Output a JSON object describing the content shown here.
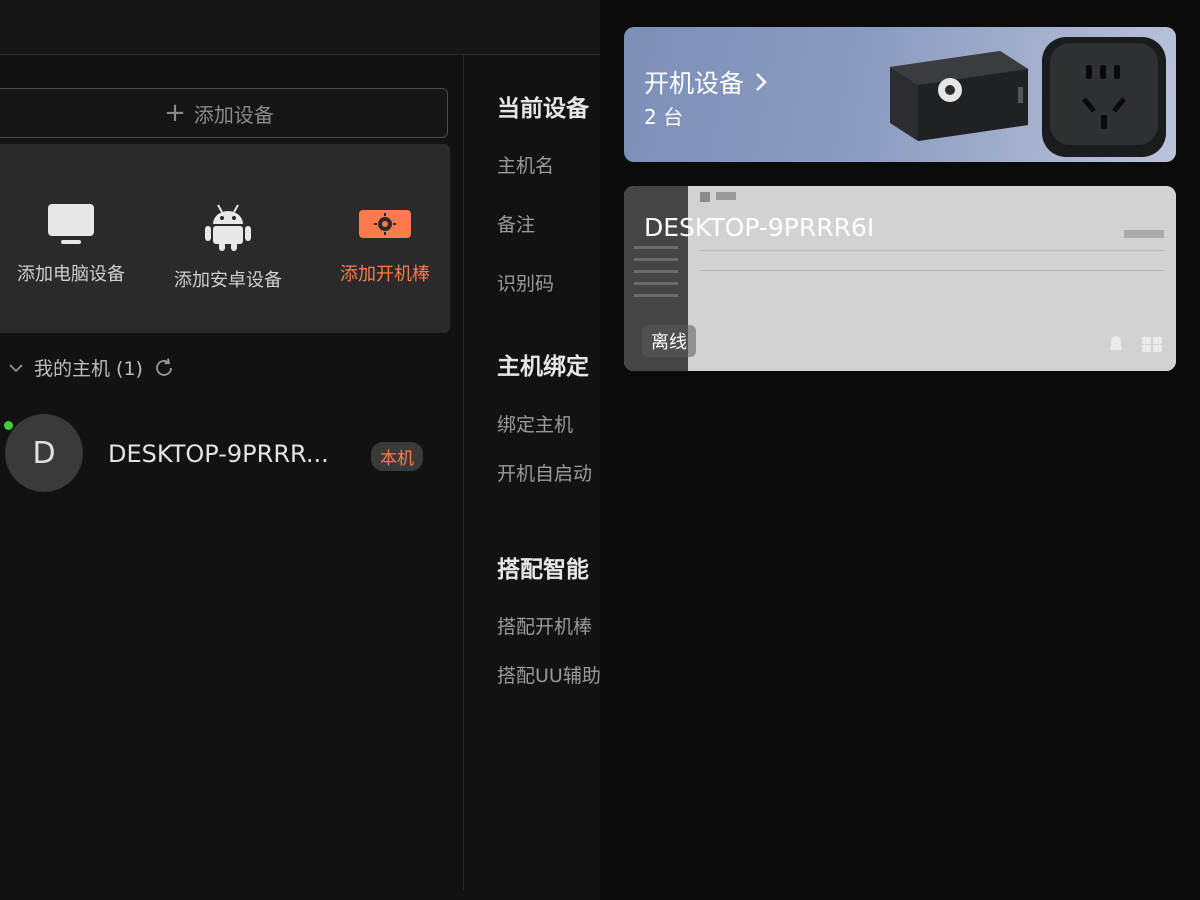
{
  "left_panel": {
    "add_device_button": "添加设备",
    "add_options": [
      {
        "label": "添加电脑设备",
        "icon": "monitor-icon"
      },
      {
        "label": "添加安卓设备",
        "icon": "android-icon"
      },
      {
        "label": "添加开机棒",
        "icon": "boot-stick-icon"
      }
    ],
    "my_hosts": {
      "label": "我的主机 (1)"
    },
    "hosts": [
      {
        "avatar_letter": "D",
        "name": "DESKTOP-9PRRR...",
        "badge": "本机",
        "online": true
      }
    ]
  },
  "detail_panel": {
    "current_device_heading": "当前设备",
    "hostname_label": "主机名",
    "remark_label": "备注",
    "id_code_label": "识别码",
    "host_binding_heading": "主机绑定",
    "bind_host_label": "绑定主机",
    "autostart_label": "开机自启动",
    "smart_pairing_heading": "搭配智能",
    "pair_boot_stick_label": "搭配开机棒",
    "pair_uu_label": "搭配UU辅助"
  },
  "overlay": {
    "boot_devices_card": {
      "title": "开机设备",
      "count": "2 台"
    },
    "desktop_card": {
      "title": "DESKTOP-9PRRR6I",
      "status": "离线"
    }
  },
  "colors": {
    "accent": "#ff7a4d",
    "online": "#3fcf3a",
    "background": "#121212",
    "overlay_background": "#0b0b0b"
  }
}
